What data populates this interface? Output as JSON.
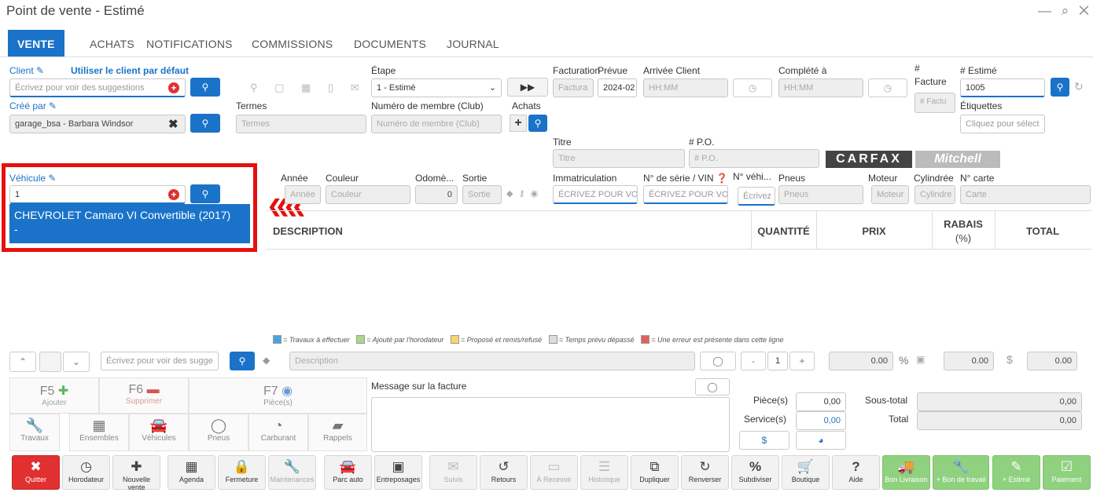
{
  "window": {
    "title": "Point de vente - Estimé",
    "controls": "— ⌕ ✕"
  },
  "tabs": [
    "VENTE",
    "ACHATS",
    "NOTIFICATIONS",
    "COMMISSIONS",
    "DOCUMENTS",
    "JOURNAL"
  ],
  "client": {
    "label": "Client",
    "default_link": "Utiliser le client par défaut",
    "placeholder": "Écrivez pour voir des suggestions"
  },
  "cree_par": {
    "label": "Créé par",
    "value": "garage_bsa - Barbara Windsor"
  },
  "termes": {
    "label": "Termes",
    "placeholder": "Termes"
  },
  "etape": {
    "label": "Étape",
    "value": "1 - Estimé"
  },
  "membre": {
    "label": "Numéro de membre (Club)",
    "placeholder": "Numéro de membre (Club)"
  },
  "achats": {
    "label": "Achats"
  },
  "facturation": {
    "label": "Facturation",
    "placeholder": "Factura"
  },
  "prevue": {
    "label": "Prévue",
    "value": "2024-02"
  },
  "arrivee": {
    "label": "Arrivée Client",
    "placeholder": "HH:MM"
  },
  "complete": {
    "label": "Complété à",
    "placeholder": "HH:MM"
  },
  "facture": {
    "hash": "#",
    "label": "Facture",
    "placeholder": "# Factu"
  },
  "estime": {
    "label": "# Estimé",
    "value": "1005"
  },
  "etiquettes": {
    "label": "Étiquettes",
    "placeholder": "Cliquez pour sélect"
  },
  "titre": {
    "label": "Titre",
    "placeholder": "Titre"
  },
  "po": {
    "label": "# P.O.",
    "placeholder": "# P.O."
  },
  "logos": {
    "carfax": "CARFAX",
    "mitchell": "Mitchell"
  },
  "vehicule": {
    "label": "Véhicule",
    "value": "1",
    "suggestion": "CHEVROLET Camaro VI Convertible (2017)",
    "suggestion_sub": "-"
  },
  "veh_fields": [
    {
      "label": "Année",
      "ph": "Année"
    },
    {
      "label": "Couleur",
      "ph": "Couleur"
    },
    {
      "label": "Odomè...",
      "ph": "0"
    },
    {
      "label": "Sortie",
      "ph": "Sortie"
    },
    {
      "label": "Immatriculation",
      "ph": "ÉCRIVEZ POUR VO"
    },
    {
      "label": "N° de série / VIN",
      "ph": "ÉCRIVEZ POUR VO"
    },
    {
      "label": "N° véhi...",
      "ph": "Écrivez"
    },
    {
      "label": "Pneus",
      "ph": "Pneus"
    },
    {
      "label": "Moteur",
      "ph": "Moteur"
    },
    {
      "label": "Cylindrée",
      "ph": "Cylindre"
    },
    {
      "label": "N° carte",
      "ph": "Carte"
    }
  ],
  "table": {
    "cols": [
      "DESCRIPTION",
      "QUANTITÉ",
      "PRIX",
      "RABAIS",
      "(%)",
      "TOTAL"
    ]
  },
  "legend": [
    "= Travaux à effectuer",
    "= Ajouté par l'horodateur",
    "= Proposé et remis/refusé",
    "= Temps prévu dépassé",
    "= Une erreur est présente dans cette ligne"
  ],
  "legend_colors": [
    "#4aa3df",
    "#a8d88c",
    "#f5d76e",
    "#dddddd",
    "#e06060"
  ],
  "line": {
    "search_ph": "Écrivez pour voir des sugge",
    "desc_ph": "Description",
    "qty": "1",
    "price": "0.00",
    "discount": "0.00",
    "total": "0.00"
  },
  "fkeys": [
    {
      "k": "F5",
      "l": "Ajouter"
    },
    {
      "k": "F6",
      "l": "Supprimer"
    },
    {
      "k": "F7",
      "l": "Pièce(s)"
    }
  ],
  "icons": [
    "Travaux",
    "Ensembles",
    "Véhicules",
    "Pneus",
    "Carburant",
    "Rappels"
  ],
  "message": {
    "label": "Message sur la facture"
  },
  "totals": {
    "pieces_label": "Pièce(s)",
    "pieces": "0,00",
    "service_label": "Service(s)",
    "service": "0,00",
    "sous_total_label": "Sous-total",
    "sous_total": "0,00",
    "total_label": "Total",
    "total": "0,00"
  },
  "toolbar": [
    "Quitter",
    "Horodateur",
    "Nouvelle vente",
    "Agenda",
    "Fermeture",
    "Maintenances",
    "Parc auto",
    "Entreposages",
    "Suivis",
    "Retours",
    "À Recevoir",
    "Historique",
    "Dupliquer",
    "Renverser",
    "Subdiviser",
    "Boutique",
    "Aide",
    "Bon Livraison",
    "+ Bon de travail",
    "+ Estimé",
    "Paiement"
  ]
}
